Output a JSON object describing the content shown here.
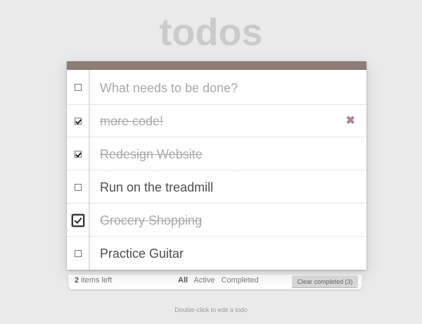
{
  "header": {
    "title": "todos"
  },
  "new_todo": {
    "placeholder": "What needs to be done?"
  },
  "todos": [
    {
      "label": "more code!",
      "completed": true
    },
    {
      "label": "Redesign Website",
      "completed": true
    },
    {
      "label": "Run on the treadmill",
      "completed": false
    },
    {
      "label": "Grocery Shopping",
      "completed": true
    },
    {
      "label": "Practice Guitar",
      "completed": false
    }
  ],
  "footer": {
    "count_number": "2",
    "count_suffix": " items left",
    "filters": [
      "All",
      "Active",
      "Completed"
    ],
    "clear_label": "Clear completed (3)"
  },
  "info": {
    "hint": "Double-click to edit a todo"
  },
  "icons": {
    "delete": "close-icon"
  },
  "colors": {
    "topbar": "#8d7d77",
    "background": "#eaeaea"
  }
}
